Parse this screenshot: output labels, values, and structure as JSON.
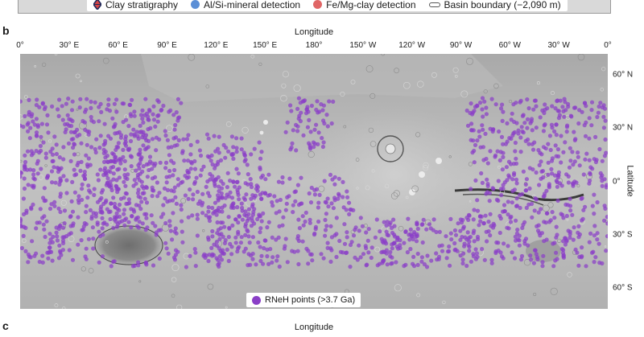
{
  "top_legend": {
    "items": [
      {
        "label": "Clay stratigraphy",
        "icon": "diamond-marker-icon"
      },
      {
        "label": "Al/Si-mineral detection",
        "color": "#5b8fd6"
      },
      {
        "label": "Fe/Mg-clay detection",
        "color": "#e06666"
      },
      {
        "label": "Basin boundary (−2,090 m)",
        "icon": "basin-boundary-line-icon"
      }
    ]
  },
  "panel_b": {
    "label": "b",
    "x_axis_title": "Longitude",
    "y_axis_title": "Latitude",
    "lon_ticks": [
      {
        "label": "0°",
        "lon": 0
      },
      {
        "label": "30° E",
        "lon": 30
      },
      {
        "label": "60° E",
        "lon": 60
      },
      {
        "label": "90° E",
        "lon": 90
      },
      {
        "label": "120° E",
        "lon": 120
      },
      {
        "label": "150° E",
        "lon": 150
      },
      {
        "label": "180°",
        "lon": 180
      },
      {
        "label": "150° W",
        "lon": 210
      },
      {
        "label": "120° W",
        "lon": 240
      },
      {
        "label": "90° W",
        "lon": 270
      },
      {
        "label": "60° W",
        "lon": 300
      },
      {
        "label": "30° W",
        "lon": 330
      },
      {
        "label": "0°",
        "lon": 360
      }
    ],
    "lat_ticks": [
      {
        "label": "60° N",
        "lat": 60
      },
      {
        "label": "30° N",
        "lat": 30
      },
      {
        "label": "0°",
        "lat": 0
      },
      {
        "label": "30° S",
        "lat": -30
      },
      {
        "label": "60° S",
        "lat": -60
      }
    ],
    "lat_range": [
      -72,
      72
    ],
    "lon_range": [
      0,
      360
    ],
    "legend_label": "RNeH points (>3.7 Ga)",
    "point_color": "#8a3fc7"
  },
  "panel_c": {
    "label": "c",
    "x_axis_title": "Longitude"
  }
}
